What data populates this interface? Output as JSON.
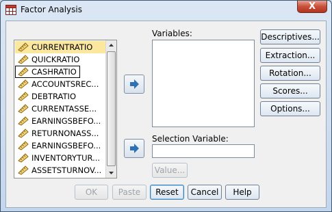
{
  "window": {
    "title": "Factor Analysis",
    "close_glyph": "X"
  },
  "variables_list": {
    "items": [
      {
        "label": "CURRENTRATIO",
        "state": "selected"
      },
      {
        "label": "QUICKRATIO",
        "state": "normal"
      },
      {
        "label": "CASHRATIO",
        "state": "focused"
      },
      {
        "label": "ACCOUNTSREC...",
        "state": "normal"
      },
      {
        "label": "DEBTRATIO",
        "state": "normal"
      },
      {
        "label": "CURRENTASSE...",
        "state": "normal"
      },
      {
        "label": "EARNINGSBEFO...",
        "state": "normal"
      },
      {
        "label": "RETURNONASS...",
        "state": "normal"
      },
      {
        "label": "EARNINGSBEFO...",
        "state": "normal"
      },
      {
        "label": "INVENTORYTUR...",
        "state": "normal"
      },
      {
        "label": "ASSETSTURNOV...",
        "state": "normal"
      }
    ],
    "item_icon": "scale-ruler-icon"
  },
  "labels": {
    "variables": "Variables:",
    "selection_variable": "Selection Variable:"
  },
  "side_buttons": {
    "descriptives": "Descriptives...",
    "extraction": "Extraction...",
    "rotation": "Rotation...",
    "scores": "Scores...",
    "options": "Options..."
  },
  "value_button": "Value...",
  "bottom_buttons": {
    "ok": "OK",
    "paste": "Paste",
    "reset": "Reset",
    "cancel": "Cancel",
    "help": "Help"
  },
  "colors": {
    "selected_item": "#fbe79d",
    "move_arrow": "#2f6fb4",
    "close_button": "#c7503a"
  }
}
